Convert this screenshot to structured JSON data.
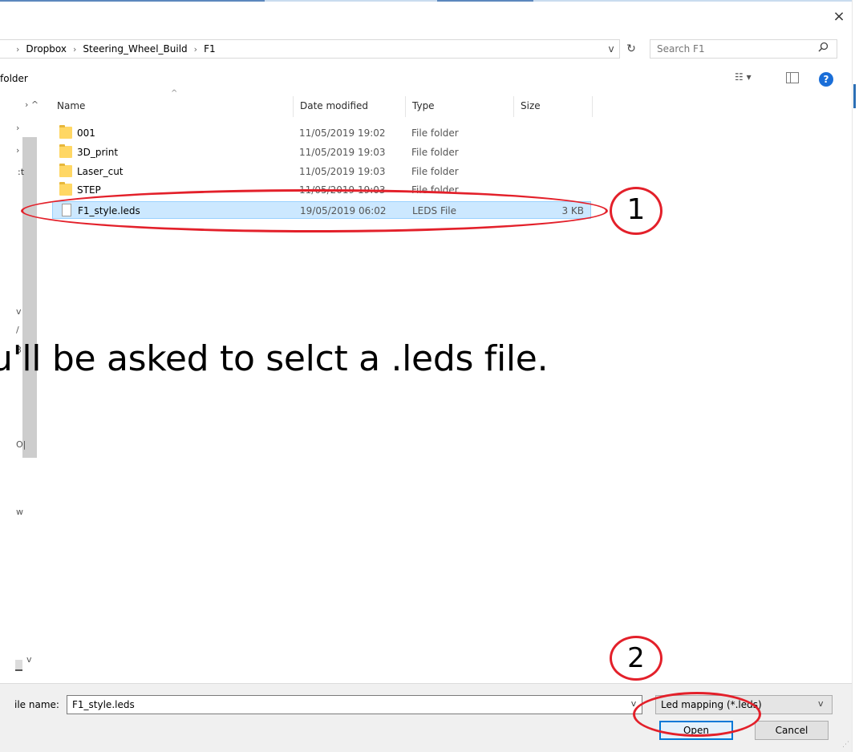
{
  "window": {
    "close_glyph": "×"
  },
  "address_bar": {
    "breadcrumbs": [
      "Dropbox",
      "Steering_Wheel_Build",
      "F1"
    ],
    "separator": "›",
    "dropdown_glyph": "v",
    "refresh_glyph": "↻"
  },
  "search": {
    "placeholder": "Search F1",
    "icon": "search-icon"
  },
  "toolbar": {
    "new_folder_label": "folder",
    "view_glyph": "☷ ▾",
    "help_glyph": "?"
  },
  "nav_pane": {
    "glyphs": [
      "›",
      "›",
      "›",
      ":t",
      "v",
      "/",
      "3",
      "O|",
      "w"
    ]
  },
  "columns": [
    {
      "label": "Name"
    },
    {
      "label": "Date modified"
    },
    {
      "label": "Type"
    },
    {
      "label": "Size"
    }
  ],
  "files": [
    {
      "name": "001",
      "date": "11/05/2019 19:02",
      "type": "File folder",
      "size": "",
      "icon": "folder-icon",
      "selected": false
    },
    {
      "name": "3D_print",
      "date": "11/05/2019 19:03",
      "type": "File folder",
      "size": "",
      "icon": "folder-icon",
      "selected": false
    },
    {
      "name": "Laser_cut",
      "date": "11/05/2019 19:03",
      "type": "File folder",
      "size": "",
      "icon": "folder-icon",
      "selected": false
    },
    {
      "name": "STEP",
      "date": "11/05/2019 19:03",
      "type": "File folder",
      "size": "",
      "icon": "folder-icon",
      "selected": false
    },
    {
      "name": "F1_style.leds",
      "date": "19/05/2019 06:02",
      "type": "LEDS File",
      "size": "3 KB",
      "icon": "file-icon",
      "selected": true
    }
  ],
  "annotations": {
    "step1": "1",
    "step2": "2",
    "caption": "u'll be asked to selct a .leds file."
  },
  "bottom": {
    "filename_label": "ile name:",
    "filename_value": "F1_style.leds",
    "filter_value": "Led mapping (*.leds)",
    "dropdown_glyph": "v",
    "open_label": "Open",
    "cancel_label": "Cancel"
  },
  "colors": {
    "annotation_red": "#e3202a",
    "selection_bg": "#cce8ff",
    "selection_border": "#99d1ff",
    "accent_blue": "#0078d7",
    "folder_yellow": "#ffd764"
  }
}
